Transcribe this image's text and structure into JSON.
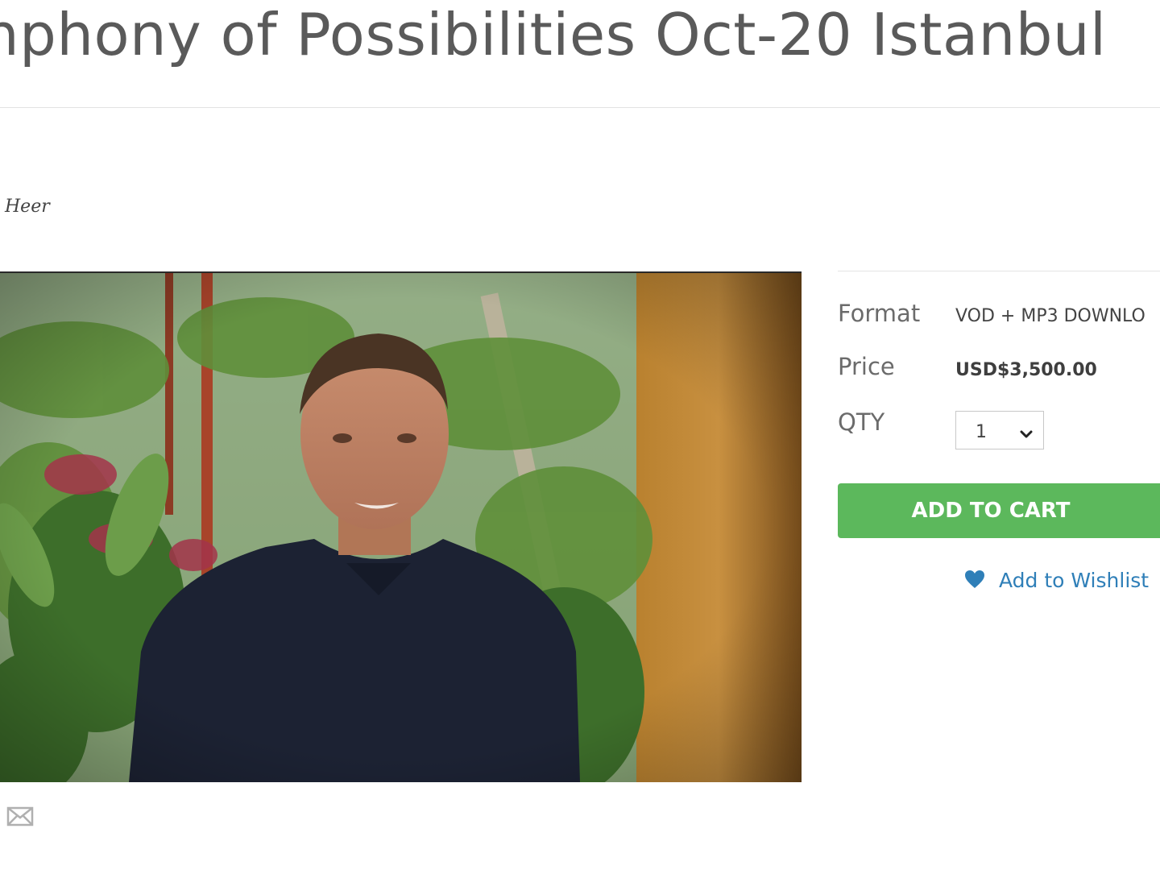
{
  "product": {
    "title": "nphony of Possibilities Oct-20 Istanbul",
    "author": "Heer"
  },
  "options": {
    "format_label": "Format",
    "format_value": "VOD + MP3 DOWNLO",
    "price_label": "Price",
    "price_value": "USD$3,500.00",
    "qty_label": "QTY",
    "qty_value": "1"
  },
  "actions": {
    "add_to_cart": "ADD TO CART",
    "add_to_wishlist": "Add to Wishlist"
  },
  "icons": {
    "share": "mail-icon",
    "wishlist": "heart-icon",
    "qty_dropdown": "chevron-down-icon"
  },
  "colors": {
    "cart_button": "#5cb85c",
    "wishlist_link": "#2f7fb8",
    "title_text": "#5a5a5a"
  }
}
